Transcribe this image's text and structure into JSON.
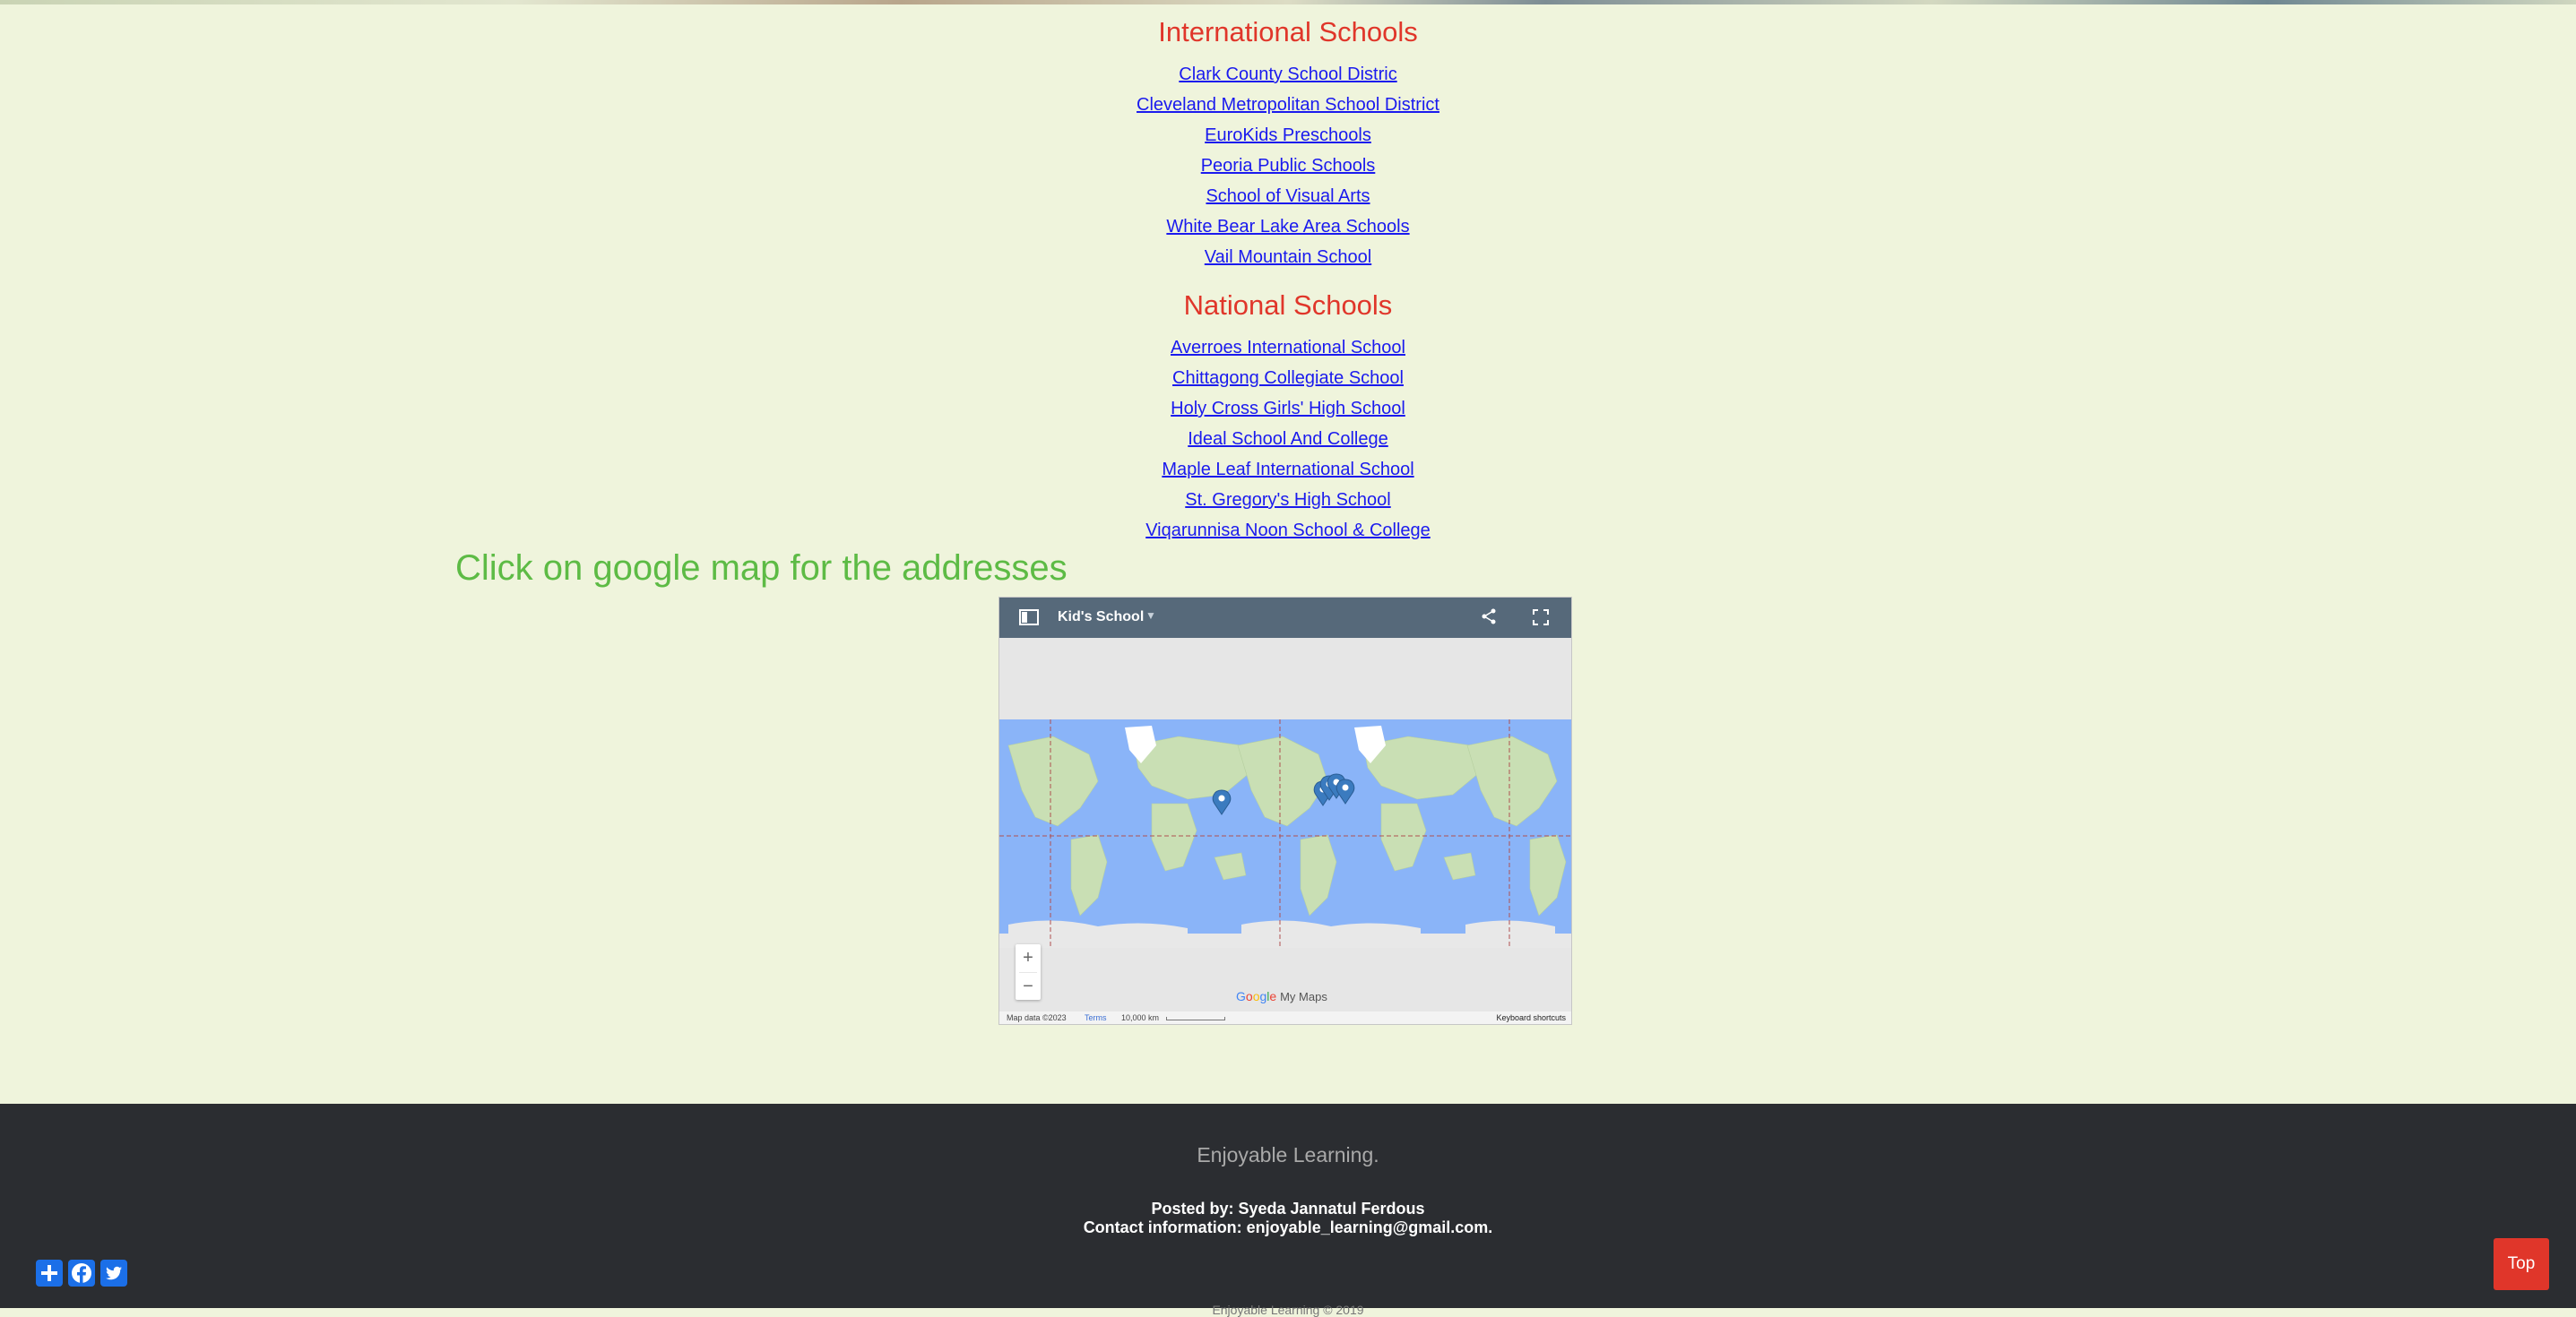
{
  "international": {
    "title": "International Schools",
    "links": [
      "Clark County School Distric",
      "Cleveland Metropolitan School District",
      "EuroKids Preschools",
      "Peoria Public Schools",
      "School of Visual Arts",
      "White Bear Lake Area Schools",
      "Vail Mountain School"
    ]
  },
  "national": {
    "title": "National Schools",
    "links": [
      "Averroes International School",
      "Chittagong Collegiate School",
      "Holy Cross Girls' High School",
      "Ideal School And College",
      "Maple Leaf International School",
      "St. Gregory's High School",
      "Viqarunnisa Noon School & College"
    ]
  },
  "map": {
    "caption": "Click on google map for the addresses",
    "title": "Kid's School",
    "zoom_in": "+",
    "zoom_out": "−",
    "google_letters": [
      "G",
      "o",
      "o",
      "g",
      "l",
      "e"
    ],
    "product": "My Maps",
    "map_data": "Map data ©2023",
    "terms": "Terms",
    "scale": "10,000 km",
    "keyboard": "Keyboard shortcuts"
  },
  "footer": {
    "tagline": "Enjoyable Learning.",
    "posted_by": "Posted by: Syeda Jannatul Ferdous",
    "contact": "Contact information: enjoyable_learning@gmail.com.",
    "copyright": "Enjoyable Learning © 2019"
  },
  "share": {
    "icons": [
      "plus-icon",
      "facebook-icon",
      "twitter-icon"
    ]
  },
  "top_button": "Top",
  "colors": {
    "page_bg": "#eff4dc",
    "heading": "#e0362a",
    "link": "#1a1aee",
    "caption": "#5dbb45",
    "footer_bg": "#2b2d31",
    "share": "#1b6fe8",
    "map_header": "#56697a",
    "ocean": "#8ab4f8",
    "land": "#c8e0b4"
  }
}
